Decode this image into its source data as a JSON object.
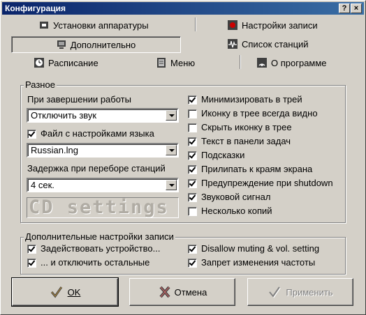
{
  "window": {
    "title": "Конфигурация",
    "help_btn": "?",
    "close_btn": "×"
  },
  "tabs": [
    {
      "label": "Установки аппаратуры",
      "icon": "hardware-icon"
    },
    {
      "label": "Настройки записи",
      "icon": "record-icon"
    },
    {
      "label": "Дополнительно",
      "icon": "monitor-icon",
      "active": true
    },
    {
      "label": "Список станций",
      "icon": "waveform-icon"
    },
    {
      "label": "Расписание",
      "icon": "clock-icon"
    },
    {
      "label": "Меню",
      "icon": "menu-icon"
    },
    {
      "label": "О программе",
      "icon": "about-icon"
    }
  ],
  "misc": {
    "group_label": "Разное",
    "on_exit_label": "При завершении работы",
    "on_exit_value": "Отключить звук",
    "language_file_label": "Файл с настройками языка",
    "language_file_checked": true,
    "language_value": "Russian.lng",
    "scan_delay_label": "Задержка при переборе станций",
    "scan_delay_value": "4 сек.",
    "lcd_text": "CD settings L",
    "options": [
      {
        "label": "Минимизировать в трей",
        "checked": true
      },
      {
        "label": "Иконку в трее всегда видно",
        "checked": false
      },
      {
        "label": "Скрыть иконку в трее",
        "checked": false
      },
      {
        "label": "Текст в панели задач",
        "checked": true
      },
      {
        "label": "Подсказки",
        "checked": true
      },
      {
        "label": "Прилипать к краям экрана",
        "checked": true
      },
      {
        "label": "Предупреждение при shutdown",
        "checked": true
      },
      {
        "label": "Звуковой сигнал",
        "checked": true
      },
      {
        "label": "Несколько копий",
        "checked": false
      }
    ]
  },
  "record_extra": {
    "group_label": "Дополнительные настройки записи",
    "options": [
      {
        "label": "Задействовать устройство...",
        "checked": true
      },
      {
        "label": "Disallow muting & vol. setting",
        "checked": true
      },
      {
        "label": "... и отключить остальные",
        "checked": true
      },
      {
        "label": "Запрет изменения частоты",
        "checked": true
      }
    ]
  },
  "buttons": {
    "ok": "OK",
    "cancel": "Отмена",
    "apply": "Применить"
  }
}
